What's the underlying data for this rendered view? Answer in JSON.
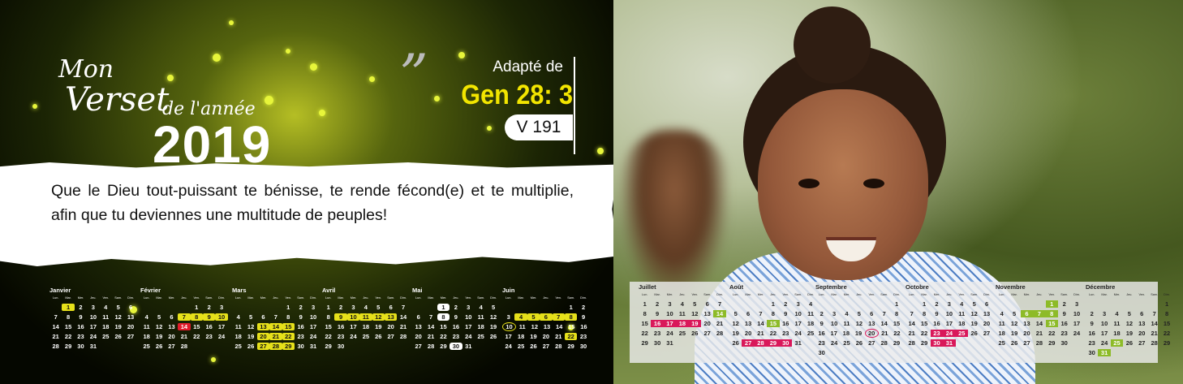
{
  "title": {
    "line1": "Mon",
    "line2": "Verset",
    "line3": "de l'année",
    "year": "2019"
  },
  "quote_mark": "”",
  "reference": {
    "adapted": "Adapté de",
    "ref": "Gen 28: 3",
    "version": "V 191"
  },
  "verse": "Que le Dieu tout-puissant te bénisse, te rende fécond(e) et te multiplie, afin que tu deviennes une multitude de peuples!",
  "day_headers": [
    "Lun.",
    "Mar.",
    "Mer.",
    "Jeu.",
    "Ven.",
    "Sam.",
    "Dim."
  ],
  "months": [
    {
      "name": "Janvier",
      "rows": [
        [
          "",
          "1",
          "2",
          "3",
          "4",
          "5",
          "6"
        ],
        [
          "7",
          "8",
          "9",
          "10",
          "11",
          "12",
          "13"
        ],
        [
          "14",
          "15",
          "16",
          "17",
          "18",
          "19",
          "20"
        ],
        [
          "21",
          "22",
          "23",
          "24",
          "25",
          "26",
          "27"
        ],
        [
          "28",
          "29",
          "30",
          "31",
          "",
          "",
          ""
        ]
      ]
    },
    {
      "name": "Février",
      "rows": [
        [
          "",
          "",
          "",
          "",
          "1",
          "2",
          "3"
        ],
        [
          "4",
          "5",
          "6",
          "7",
          "8",
          "9",
          "10"
        ],
        [
          "11",
          "12",
          "13",
          "14",
          "15",
          "16",
          "17"
        ],
        [
          "18",
          "19",
          "20",
          "21",
          "22",
          "23",
          "24"
        ],
        [
          "25",
          "26",
          "27",
          "28",
          "",
          "",
          ""
        ]
      ]
    },
    {
      "name": "Mars",
      "rows": [
        [
          "",
          "",
          "",
          "",
          "1",
          "2",
          "3"
        ],
        [
          "4",
          "5",
          "6",
          "7",
          "8",
          "9",
          "10"
        ],
        [
          "11",
          "12",
          "13",
          "14",
          "15",
          "16",
          "17"
        ],
        [
          "18",
          "19",
          "20",
          "21",
          "22",
          "23",
          "24"
        ],
        [
          "25",
          "26",
          "27",
          "28",
          "29",
          "30",
          "31"
        ]
      ]
    },
    {
      "name": "Avril",
      "rows": [
        [
          "1",
          "2",
          "3",
          "4",
          "5",
          "6",
          "7"
        ],
        [
          "8",
          "9",
          "10",
          "11",
          "12",
          "13",
          "14"
        ],
        [
          "15",
          "16",
          "17",
          "18",
          "19",
          "20",
          "21"
        ],
        [
          "22",
          "23",
          "24",
          "25",
          "26",
          "27",
          "28"
        ],
        [
          "29",
          "30",
          "",
          "",
          "",
          "",
          ""
        ]
      ]
    },
    {
      "name": "Mai",
      "rows": [
        [
          "",
          "",
          "1",
          "2",
          "3",
          "4",
          "5"
        ],
        [
          "6",
          "7",
          "8",
          "9",
          "10",
          "11",
          "12"
        ],
        [
          "13",
          "14",
          "15",
          "16",
          "17",
          "18",
          "19"
        ],
        [
          "20",
          "21",
          "22",
          "23",
          "24",
          "25",
          "26"
        ],
        [
          "27",
          "28",
          "29",
          "30",
          "31",
          "",
          ""
        ]
      ]
    },
    {
      "name": "Juin",
      "rows": [
        [
          "",
          "",
          "",
          "",
          "",
          "1",
          "2"
        ],
        [
          "3",
          "4",
          "5",
          "6",
          "7",
          "8",
          "9"
        ],
        [
          "10",
          "11",
          "12",
          "13",
          "14",
          "15",
          "16"
        ],
        [
          "17",
          "18",
          "19",
          "20",
          "21",
          "22",
          "23"
        ],
        [
          "24",
          "25",
          "26",
          "27",
          "28",
          "29",
          "30"
        ]
      ]
    },
    {
      "name": "Juillet",
      "rows": [
        [
          "1",
          "2",
          "3",
          "4",
          "5",
          "6",
          "7"
        ],
        [
          "8",
          "9",
          "10",
          "11",
          "12",
          "13",
          "14"
        ],
        [
          "15",
          "16",
          "17",
          "18",
          "19",
          "20",
          "21"
        ],
        [
          "22",
          "23",
          "24",
          "25",
          "26",
          "27",
          "28"
        ],
        [
          "29",
          "30",
          "31",
          "",
          "",
          "",
          ""
        ]
      ]
    },
    {
      "name": "Août",
      "rows": [
        [
          "",
          "",
          "",
          "1",
          "2",
          "3",
          "4"
        ],
        [
          "5",
          "6",
          "7",
          "8",
          "9",
          "10",
          "11"
        ],
        [
          "12",
          "13",
          "14",
          "15",
          "16",
          "17",
          "18"
        ],
        [
          "19",
          "20",
          "21",
          "22",
          "23",
          "24",
          "25"
        ],
        [
          "26",
          "27",
          "28",
          "29",
          "30",
          "31",
          ""
        ]
      ]
    },
    {
      "name": "Septembre",
      "rows": [
        [
          "",
          "",
          "",
          "",
          "",
          "",
          "1"
        ],
        [
          "2",
          "3",
          "4",
          "5",
          "6",
          "7",
          "8"
        ],
        [
          "9",
          "10",
          "11",
          "12",
          "13",
          "14",
          "15"
        ],
        [
          "16",
          "17",
          "18",
          "19",
          "20",
          "21",
          "22"
        ],
        [
          "23",
          "24",
          "25",
          "26",
          "27",
          "28",
          "29"
        ],
        [
          "30",
          "",
          "",
          "",
          "",
          "",
          ""
        ]
      ]
    },
    {
      "name": "Octobre",
      "rows": [
        [
          "",
          "1",
          "2",
          "3",
          "4",
          "5",
          "6"
        ],
        [
          "7",
          "8",
          "9",
          "10",
          "11",
          "12",
          "13"
        ],
        [
          "14",
          "15",
          "16",
          "17",
          "18",
          "19",
          "20"
        ],
        [
          "21",
          "22",
          "23",
          "24",
          "25",
          "26",
          "27"
        ],
        [
          "28",
          "29",
          "30",
          "31",
          "",
          "",
          ""
        ]
      ]
    },
    {
      "name": "Novembre",
      "rows": [
        [
          "",
          "",
          "",
          "",
          "1",
          "2",
          "3"
        ],
        [
          "4",
          "5",
          "6",
          "7",
          "8",
          "9",
          "10"
        ],
        [
          "11",
          "12",
          "13",
          "14",
          "15",
          "16",
          "17"
        ],
        [
          "18",
          "19",
          "20",
          "21",
          "22",
          "23",
          "24"
        ],
        [
          "25",
          "26",
          "27",
          "28",
          "29",
          "30",
          ""
        ]
      ]
    },
    {
      "name": "Décembre",
      "rows": [
        [
          "",
          "",
          "",
          "",
          "",
          "",
          "1"
        ],
        [
          "2",
          "3",
          "4",
          "5",
          "6",
          "7",
          "8"
        ],
        [
          "9",
          "10",
          "11",
          "12",
          "13",
          "14",
          "15"
        ],
        [
          "16",
          "17",
          "18",
          "19",
          "20",
          "21",
          "22"
        ],
        [
          "23",
          "24",
          "25",
          "26",
          "27",
          "28",
          "29"
        ],
        [
          "30",
          "31",
          "",
          "",
          "",
          "",
          ""
        ]
      ]
    }
  ],
  "highlights": {
    "0": {
      "1": "hl-y"
    },
    "1": {
      "7": "hl-y",
      "8": "hl-y",
      "9": "hl-y",
      "10": "hl-y",
      "14": "hl-r"
    },
    "2": {
      "13": "hl-y",
      "14": "hl-y",
      "15": "hl-y",
      "20": "hl-y",
      "21": "hl-y",
      "22": "hl-y",
      "27": "hl-y",
      "28": "hl-y",
      "29": "hl-y"
    },
    "3": {
      "9": "hl-y",
      "10": "hl-y",
      "11": "hl-y",
      "12": "hl-y",
      "13": "hl-y"
    },
    "4": {
      "1": "hl-w",
      "8": "hl-w",
      "30": "hl-w"
    },
    "5": {
      "4": "hl-y",
      "5": "hl-y",
      "6": "hl-y",
      "7": "hl-y",
      "8": "hl-y",
      "10": "hl-o",
      "22": "hl-y"
    },
    "6": {
      "14": "hl-green",
      "16": "hl-pink",
      "17": "hl-pink",
      "18": "hl-pink",
      "19": "hl-pink"
    },
    "7": {
      "15": "hl-green",
      "27": "hl-pink",
      "28": "hl-pink",
      "29": "hl-pink",
      "30": "hl-pink"
    },
    "8": {
      "20": "hl-rring"
    },
    "9": {
      "23": "hl-pink",
      "24": "hl-pink",
      "25": "hl-pink",
      "30": "hl-pink",
      "31": "hl-pink"
    },
    "10": {
      "1": "hl-green",
      "6": "hl-green",
      "7": "hl-green",
      "8": "hl-green",
      "15": "hl-green"
    },
    "11": {
      "25": "hl-green",
      "31": "hl-green"
    }
  },
  "colors": {
    "accent_yellow": "#f2e500",
    "accent_pink": "#d9185a",
    "accent_green": "#8dbb28"
  }
}
